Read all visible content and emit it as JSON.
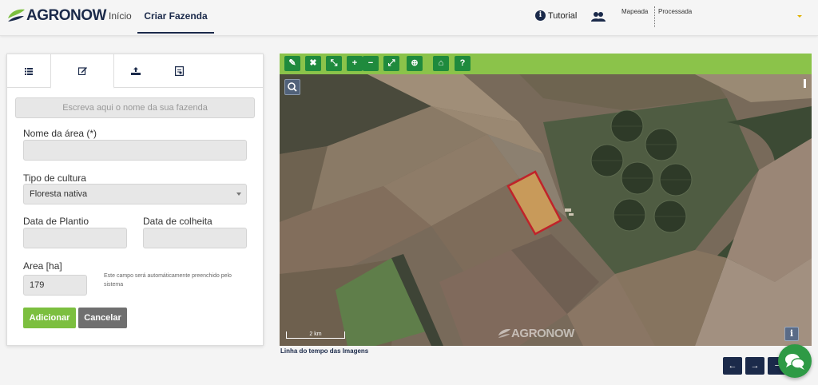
{
  "header": {
    "logo_text_a": "AGRO",
    "logo_text_b": "NOW",
    "nav_inicio": "Início",
    "nav_criar": "Criar Fazenda",
    "tutorial": "Tutorial",
    "info_glyph": "i",
    "status_mapeada": "Mapeada",
    "status_processada": "Processada",
    "brand_color": "#1b2a4a",
    "accent_color": "#8bc34a"
  },
  "panel": {
    "tabs": [
      {
        "icon": "list-icon"
      },
      {
        "icon": "edit-icon",
        "active": true
      },
      {
        "icon": "upload-icon"
      },
      {
        "icon": "document-icon"
      }
    ],
    "farm_name_placeholder": "Escreva aqui o nome da sua fazenda",
    "area_name_label": "Nome da área (*)",
    "area_name_value": "",
    "crop_type_label": "Tipo de cultura",
    "crop_type_value": "Floresta nativa",
    "plant_date_label": "Data de Plantio",
    "harvest_date_label": "Data de colheita",
    "area_label": "Area [ha]",
    "area_value": "179",
    "area_hint": "Este campo será automáticamente preenchido pelo sistema",
    "add_button": "Adicionar",
    "cancel_button": "Cancelar"
  },
  "map": {
    "toolbar": [
      {
        "icon": "pencil-icon",
        "glyph": "✎"
      },
      {
        "icon": "close-icon",
        "glyph": "✖"
      },
      {
        "icon": "shrink-icon",
        "glyph": "⤡"
      },
      {
        "icon": "zoom-in-icon",
        "glyph": "+"
      },
      {
        "icon": "zoom-out-icon",
        "glyph": "−"
      },
      {
        "icon": "expand-icon",
        "glyph": "⤢"
      },
      {
        "icon": "locate-icon",
        "glyph": "⊕"
      },
      {
        "icon": "home-icon",
        "glyph": "⌂"
      },
      {
        "icon": "help-icon",
        "glyph": "?"
      }
    ],
    "scale_label": "2 km",
    "info_glyph": "i",
    "watermark_a": "AGRO",
    "watermark_b": "NOW",
    "timeline_label": "Linha do tempo das Imagens",
    "prev_glyph": "←",
    "next_glyph": "→",
    "extra_glyph": "−"
  }
}
